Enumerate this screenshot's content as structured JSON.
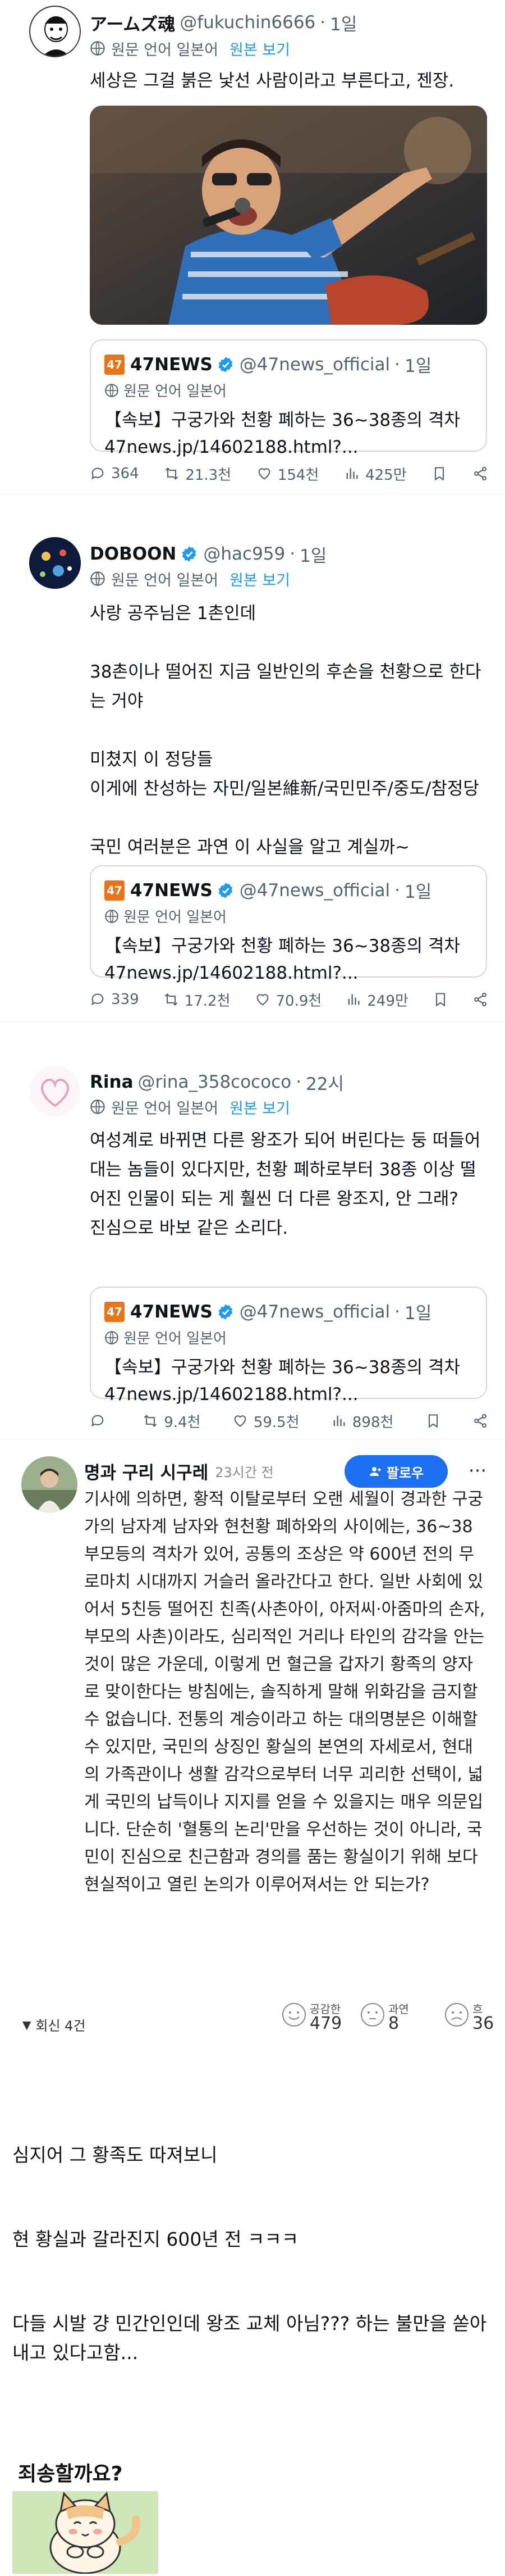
{
  "posts": [
    {
      "name": "アームズ魂",
      "handle": "@fukuchin6666",
      "time": "1일",
      "translate_label": "원문 언어 일본어",
      "text": "세상은 그걸 붉은 낯선 사람이라고 부른다고, 젠장.",
      "quote": {
        "name": "47NEWS",
        "handle": "@47news_official",
        "time": "1일",
        "translate_label": "원문 언어 일본어",
        "text": "【속보】구궁가와 천황 폐하는 36~38종의 격차\n47news.jp/14602188.html?..."
      },
      "stats": {
        "replies": "364",
        "reposts": "21.3천",
        "likes": "154천",
        "views": "425만"
      }
    },
    {
      "name": "DOBOON",
      "handle": "@hac959",
      "time": "1일",
      "translate_label": "원문 언어 일본어",
      "original_label": "원본 보기",
      "text": "사랑 공주님은 1촌인데\n\n38촌이나 떨어진 지금 일반인의 후손을 천황으로 한다는 거야\n\n미쳤지 이 정당들\n이게에 찬성하는 자민/일본維新/국민민주/중도/참정당\n\n국민 여러분은 과연 이 사실을 알고 계실까~",
      "quote": {
        "name": "47NEWS",
        "handle": "@47news_official",
        "time": "1일",
        "translate_label": "원문 언어 일본어",
        "text": "【속보】구궁가와 천황 폐하는 36~38종의 격차\n47news.jp/14602188.html?..."
      },
      "stats": {
        "replies": "339",
        "reposts": "17.2천",
        "likes": "70.9천",
        "views": "249만"
      }
    },
    {
      "name": "Rina",
      "handle": "@rina_358cococo",
      "time": "22시",
      "translate_label": "원문 언어 일본어",
      "original_label": "원본 보기",
      "text": "여성계로 바뀌면 다른 왕조가 되어 버린다는 둥 떠들어대는 놈들이 있다지만, 천황 폐하로부터 38종 이상 떨어진 인물이 되는 게 훨씬 더 다른 왕조지, 안 그래?\n진심으로 바보 같은 소리다.",
      "quote": {
        "name": "47NEWS",
        "handle": "@47news_official",
        "time": "1일",
        "translate_label": "원문 언어 일본어",
        "text": "【속보】구궁가와 천황 폐하는 36~38종의 격차\n47news.jp/14602188.html?..."
      },
      "stats": {
        "replies": "",
        "reposts": "9.4천",
        "likes": "59.5천",
        "views": "898천"
      }
    }
  ],
  "first_post_original_label": "원본 보기",
  "comment": {
    "name": "명과 구리 시구레",
    "time": "23시간 전",
    "follow_label": "팔로우",
    "more_label": "···",
    "text": "기사에 의하면, 황적 이탈로부터 오랜 세월이 경과한 구궁가의 남자계 남자와 현천황 폐하와의 사이에는, 36~38부모등의 격차가 있어, 공통의 조상은 약 600년 전의 무로마치 시대까지 거슬러 올라간다고 한다. 일반 사회에 있어서 5친등 떨어진 친족(사촌아이, 아저씨·아줌마의 손자, 부모의 사촌)이라도, 심리적인 거리나 타인의 감각을 안는 것이 많은 가운데, 이렇게 먼 혈근을 갑자기 황족의 양자로 맞이한다는 방침에는, 솔직하게 말해 위화감을 금지할 수 없습니다. 전통의 계승이라고 하는 대의명분은 이해할 수 있지만, 국민의 상징인 황실의 본연의 자세로서, 현대의 가족관이나 생활 감각으로부터 너무 괴리한 선택이, 넓게 국민의 납득이나 지지를 얻을 수 있을지는 매우 의문입니다. 단순히 '혈통의 논리'만을 우선하는 것이 아니라, 국민이 진심으로 친근함과 경의를 품는 황실이기 위해 보다 현실적이고 열린 논의가 이루어져서는 안 되는가?",
    "replies_label": "회신 4건",
    "reactions": [
      {
        "label": "공감한",
        "value": "479"
      },
      {
        "label": "과연",
        "value": "8"
      },
      {
        "label": "흐",
        "value": "36"
      }
    ]
  },
  "footer_lines": [
    "심지어 그 황족도 따져보니",
    "현 황실과 갈라진지 600년 전 ㅋㅋㅋ",
    "다들 시발 걍 민간인인데 왕조 교체 아님??? 하는 불만을 쏟아내고 있다고함..."
  ],
  "sticker_title": "죄송할까요?",
  "colors": {
    "link": "#1d9bf0",
    "follow": "#1d6ff2",
    "muted": "#536471",
    "border": "#cfd9de",
    "news_logo": "#e8751a"
  }
}
